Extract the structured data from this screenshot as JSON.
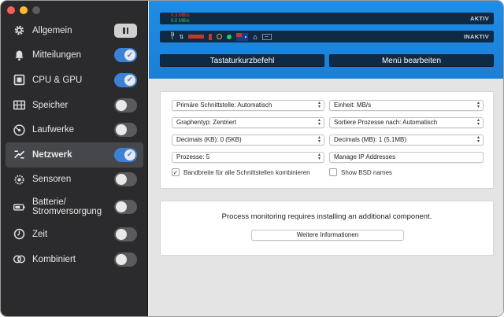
{
  "sidebar": {
    "items": [
      {
        "label": "Allgemein",
        "control": "pause"
      },
      {
        "label": "Mitteilungen",
        "control": "on"
      },
      {
        "label": "CPU & GPU",
        "control": "on"
      },
      {
        "label": "Speicher",
        "control": "off"
      },
      {
        "label": "Laufwerke",
        "control": "off"
      },
      {
        "label": "Netzwerk",
        "control": "on",
        "active": true
      },
      {
        "label": "Sensoren",
        "control": "off"
      },
      {
        "label": "Batterie/",
        "label2": "Stromversorgung",
        "control": "off"
      },
      {
        "label": "Zeit",
        "control": "off"
      },
      {
        "label": "Kombiniert",
        "control": "off"
      }
    ]
  },
  "preview": {
    "bar1": {
      "up": "0.3 MB/s",
      "down": "0.0 MB/s",
      "status": "AKTIV"
    },
    "bar2": {
      "status": "INAKTIV"
    }
  },
  "buttons": {
    "shortcut": "Tastaturkurzbefehl",
    "edit_menu": "Menü bearbeiten"
  },
  "settings": {
    "primary_interface": "Primäre Schnittstelle: Automatisch",
    "unit": "Einheit: MB/s",
    "graph_type": "Graphentyp: Zentriert",
    "sort_processes": "Sortiere Prozesse nach: Automatisch",
    "decimals_kb": "Decimals (KB): 0 (5KB)",
    "decimals_mb": "Decimals (MB): 1 (5.1MB)",
    "processes": "Prozesse: 5",
    "manage_ip": "Manage IP Addresses",
    "combine_bandwidth": "Bandbreite für alle Schnittstellen kombinieren",
    "combine_bandwidth_checked": true,
    "show_bsd": "Show BSD names",
    "show_bsd_checked": false
  },
  "process_monitoring": {
    "message": "Process monitoring requires installing an additional component.",
    "more_info": "Weitere Informationen"
  },
  "colors": {
    "accent": "#3b82d6",
    "header_blue": "#1f8de6",
    "sidebar_bg": "#2b2b2d",
    "menubar_bg": "#0f2a45",
    "upload": "#ff3b30",
    "download": "#34c759"
  }
}
